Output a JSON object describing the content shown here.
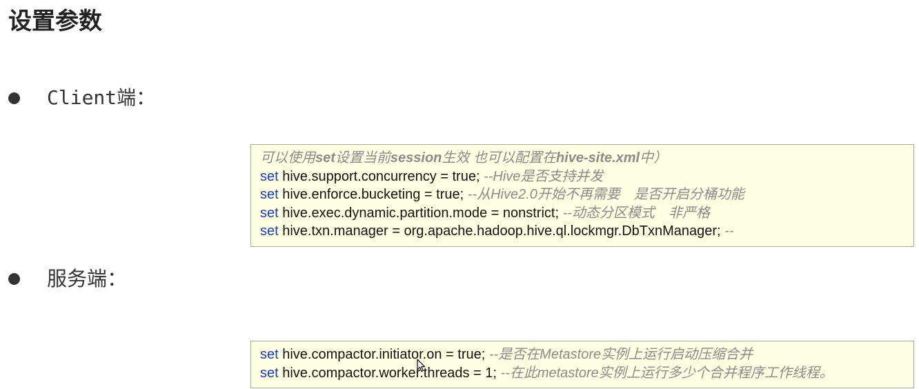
{
  "title": "设置参数",
  "sections": [
    {
      "bullet_label": "Client端：",
      "code_lines": [
        {
          "kind": "comment",
          "segments": [
            {
              "t": "可以使用",
              "s": "comment"
            },
            {
              "t": "set",
              "s": "comment-strong"
            },
            {
              "t": "设置当前",
              "s": "comment"
            },
            {
              "t": "session",
              "s": "comment-strong"
            },
            {
              "t": "生效 也可以配置在",
              "s": "comment"
            },
            {
              "t": "hive-site.xml",
              "s": "comment-strong"
            },
            {
              "t": "中）",
              "s": "comment"
            }
          ]
        },
        {
          "keyword": "set",
          "code": " hive.support.concurrency = true; ",
          "comment": "--Hive是否支持并发"
        },
        {
          "keyword": "set",
          "code": " hive.enforce.bucketing = true; ",
          "comment": "--从Hive2.0开始不再需要　是否开启分桶功能"
        },
        {
          "keyword": "set",
          "code": " hive.exec.dynamic.partition.mode = nonstrict; ",
          "comment": "--动态分区模式　非严格"
        },
        {
          "keyword": "set",
          "code": " hive.txn.manager = org.apache.hadoop.hive.ql.lockmgr.DbTxnManager; ",
          "comment": "--"
        }
      ]
    },
    {
      "bullet_label": "服务端：",
      "code_lines": [
        {
          "keyword": "set",
          "code": " hive.compactor.initiator.on = true; ",
          "comment": "--是否在Metastore实例上运行启动压缩合并"
        },
        {
          "keyword": "set",
          "code": " hive.compactor.worker.threads = 1; ",
          "comment": "--在此metastore实例上运行多少个合并程序工作线程。"
        }
      ]
    }
  ],
  "colors": {
    "keyword": "#1f3fa8",
    "comment": "#8a8a8a",
    "code_box_background": "#ffffe3",
    "code_box_border": "#a9a9a0"
  },
  "icons": {
    "cursor": "mouse-pointer-icon"
  }
}
